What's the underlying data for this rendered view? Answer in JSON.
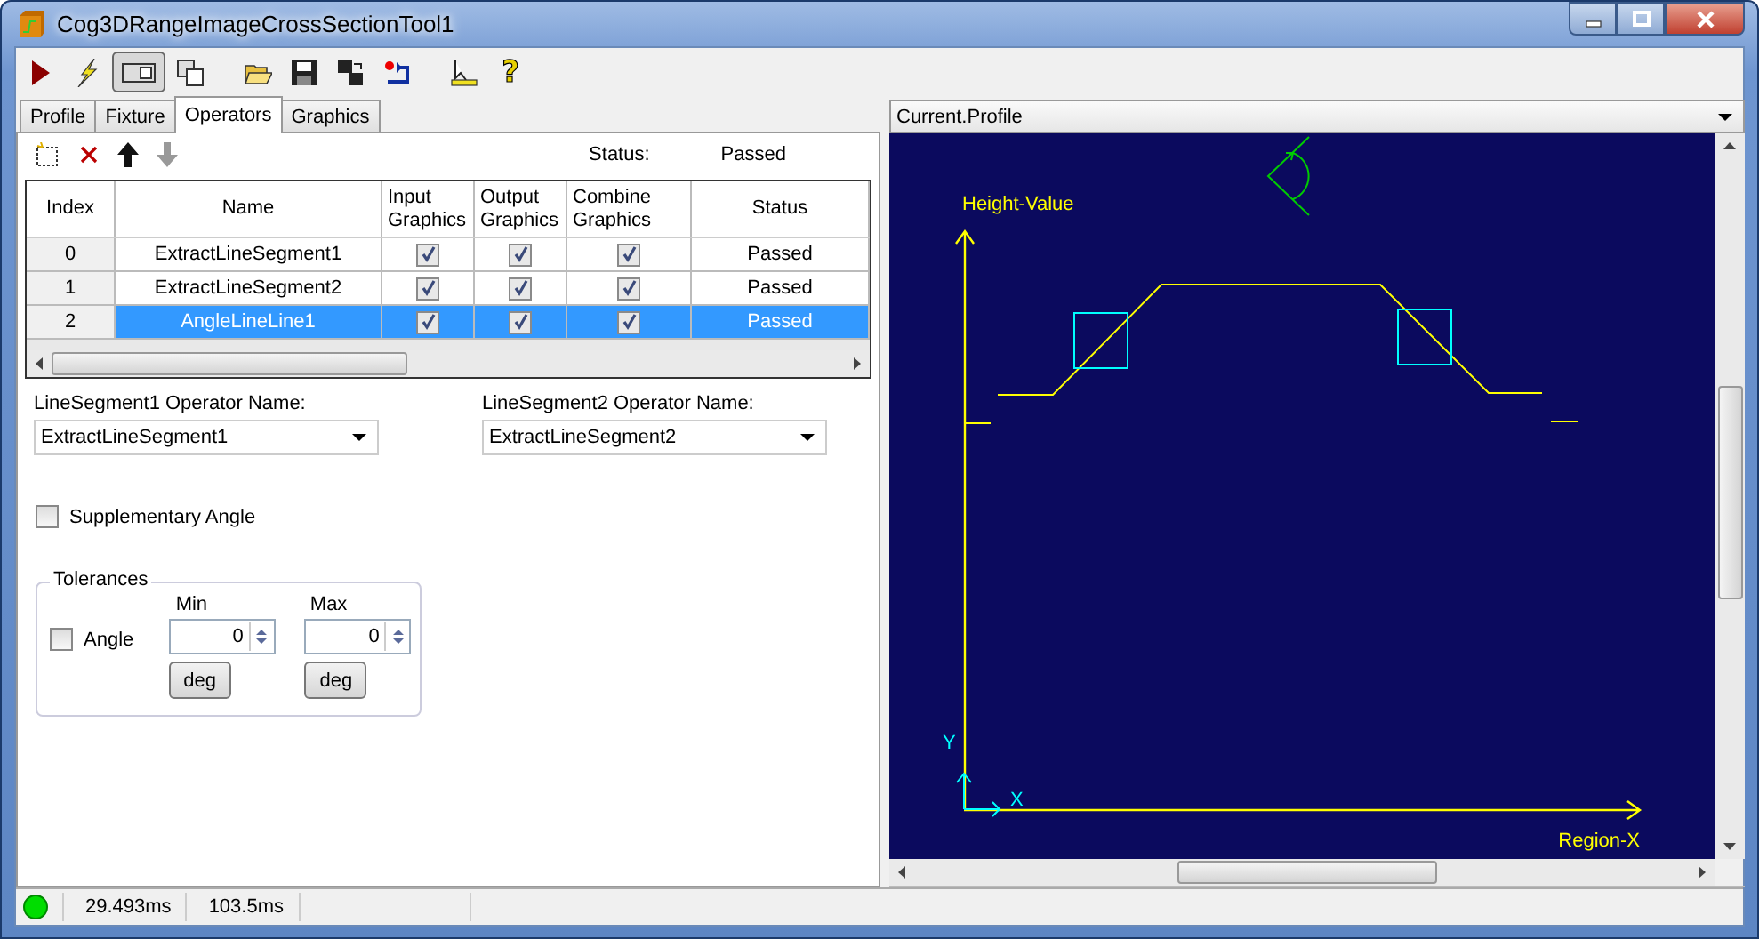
{
  "window": {
    "title": "Cog3DRangeImageCrossSectionTool1"
  },
  "toolbar": {
    "layout_toggle_pressed": true,
    "help_glyph": "?"
  },
  "tabs": [
    {
      "label": "Profile",
      "selected": false
    },
    {
      "label": "Fixture",
      "selected": false
    },
    {
      "label": "Operators",
      "selected": true
    },
    {
      "label": "Graphics",
      "selected": false
    }
  ],
  "operators_toolbar": {
    "status_label": "Status:",
    "status_value": "Passed"
  },
  "grid": {
    "columns": [
      "Index",
      "Name",
      "Input Graphics",
      "Output Graphics",
      "Combine Graphics",
      "Status"
    ],
    "rows": [
      {
        "index": "0",
        "name": "ExtractLineSegment1",
        "input_graphics": true,
        "output_graphics": true,
        "combine_graphics": true,
        "status": "Passed",
        "selected": false
      },
      {
        "index": "1",
        "name": "ExtractLineSegment2",
        "input_graphics": true,
        "output_graphics": true,
        "combine_graphics": true,
        "status": "Passed",
        "selected": false
      },
      {
        "index": "2",
        "name": "AngleLineLine1",
        "input_graphics": true,
        "output_graphics": true,
        "combine_graphics": true,
        "status": "Passed",
        "selected": true
      }
    ]
  },
  "segment1": {
    "label": "LineSegment1 Operator Name:",
    "value": "ExtractLineSegment1"
  },
  "segment2": {
    "label": "LineSegment2 Operator Name:",
    "value": "ExtractLineSegment2"
  },
  "supplementary_angle": {
    "label": "Supplementary Angle",
    "checked": false
  },
  "tolerances": {
    "title": "Tolerances",
    "angle": {
      "label": "Angle",
      "checked": false
    },
    "min": {
      "label": "Min",
      "value": "0",
      "unit": "deg"
    },
    "max": {
      "label": "Max",
      "value": "0",
      "unit": "deg"
    }
  },
  "view": {
    "selector": "Current.Profile",
    "y_label": "Height-Value",
    "x_label": "Region-X",
    "origin_y": "Y",
    "origin_x": "X"
  },
  "status_bar": {
    "ok": true,
    "times": [
      "29.493ms",
      "103.5ms"
    ]
  }
}
